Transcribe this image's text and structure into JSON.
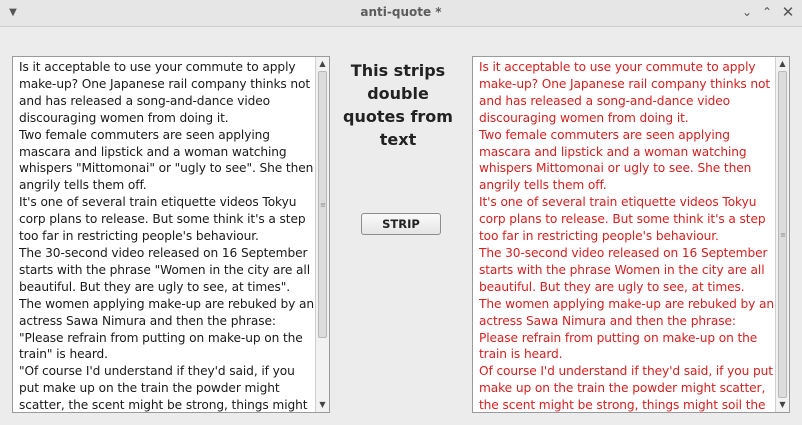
{
  "window": {
    "title": "anti-quote *",
    "menu_icon": "chevron-down-icon",
    "controls": {
      "minimize": "⌄",
      "maximize": "⌃",
      "close": "✕"
    }
  },
  "heading": "This strips double quotes from text",
  "strip_button": {
    "label": "STRIP"
  },
  "input_text": {
    "paragraphs": [
      "Is it acceptable to use your commute to apply make-up? One Japanese rail company thinks not and has released a song-and-dance video discouraging women from doing it.",
      "Two female commuters are seen applying mascara and lipstick and a woman watching whispers \"Mittomonai\" or \"ugly to see\". She then angrily tells them off.",
      "It's one of several train etiquette videos Tokyu corp plans to release. But some think it's a step too far in restricting people's behaviour.",
      "The 30-second video released on 16 September starts with the phrase \"Women in the city are all beautiful. But they are ugly to see, at times\".",
      "The women applying make-up are rebuked by an actress Sawa Nimura and then the phrase: \"Please refrain from putting on make-up on the train\" is heard.",
      "\"Of course I'd understand if they'd said, if you put make up on the train the powder might scatter, the scent might be strong, things might soil the car or"
    ]
  },
  "output_text": {
    "color": "#d42020",
    "paragraphs": [
      "Is it acceptable to use your commute to apply make-up? One Japanese rail company thinks not and has released a song-and-dance video discouraging women from doing it.",
      "Two female commuters are seen applying mascara and lipstick and a woman watching whispers Mittomonai or ugly to see. She then angrily tells them off.",
      "It's one of several train etiquette videos Tokyu corp plans to release. But some think it's a step too far in restricting people's behaviour.",
      "The 30-second video released on 16 September starts with the phrase Women in the city are all beautiful. But they are ugly to see, at times.",
      "The women applying make-up are rebuked by an actress Sawa Nimura and then the phrase: Please refrain from putting on make-up on the train is heard.",
      "Of course I'd understand if they'd said, if you put make up on the train the powder might scatter, the scent might be strong, things might soil the car or"
    ]
  },
  "scrollbar": {
    "up": "▲",
    "down": "▼",
    "grip": "≡"
  }
}
